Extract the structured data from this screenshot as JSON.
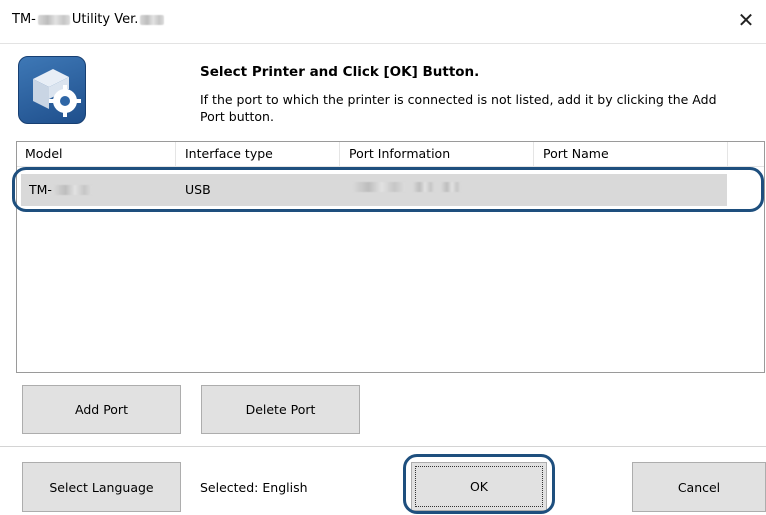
{
  "window": {
    "title_prefix": "TM-",
    "title_middle": "Utility Ver.",
    "close_glyph": "✕"
  },
  "header": {
    "heading": "Select Printer and Click [OK] Button.",
    "description": "If the port to which the printer is connected is not listed, add it by clicking the Add Port button.",
    "icon": "printer-settings-icon"
  },
  "list": {
    "columns": [
      "Model",
      "Interface type",
      "Port Information",
      "Port Name"
    ],
    "rows": [
      {
        "model_prefix": "TM-",
        "interface": "USB"
      }
    ]
  },
  "buttons": {
    "add_port": "Add Port",
    "delete_port": "Delete Port",
    "select_language": "Select Language",
    "ok": "OK",
    "cancel": "Cancel"
  },
  "language": {
    "selected_text": "Selected: English"
  },
  "colors": {
    "highlight": "#1e4f7e",
    "icon_blue": "#2f66a6",
    "row_selected": "#d9d9d9"
  }
}
